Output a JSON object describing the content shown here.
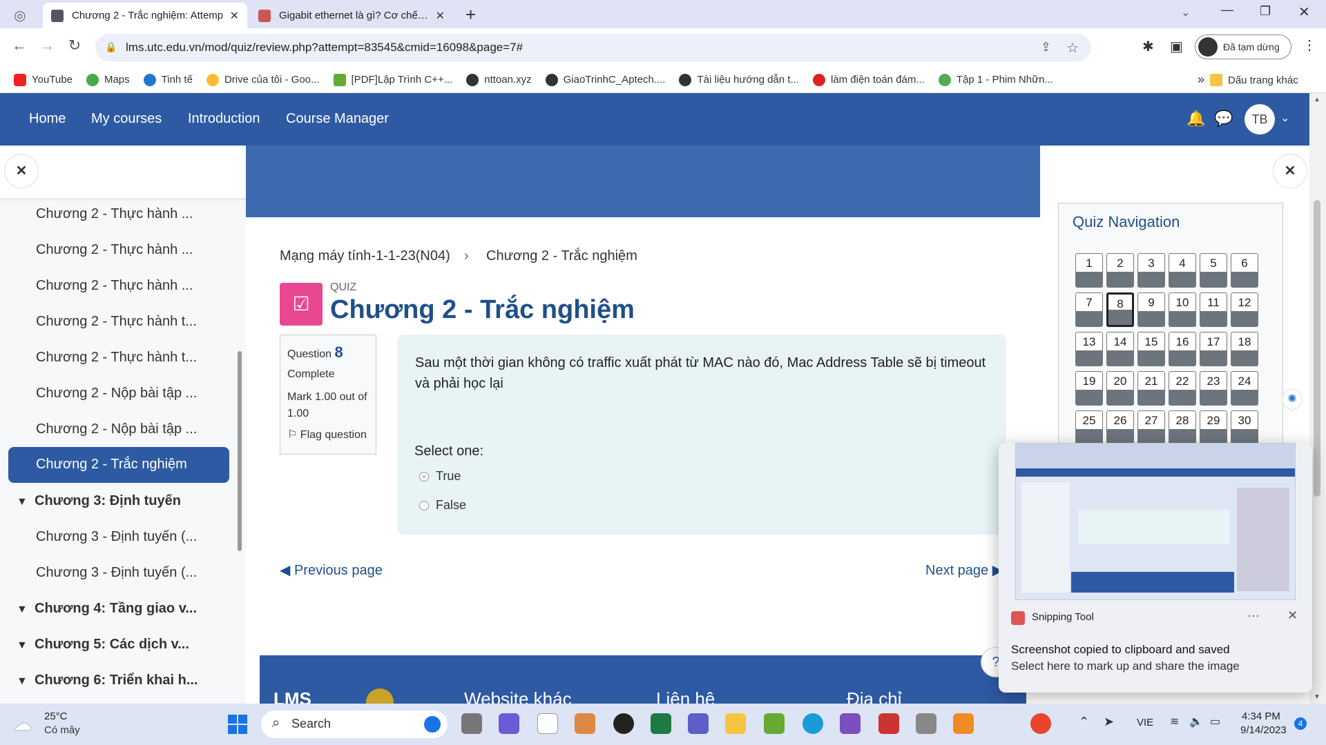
{
  "browser": {
    "tabs": [
      {
        "title": "Chương 2 - Trắc nghiệm: Attemp",
        "active": true
      },
      {
        "title": "Gigabit ethernet là gì? Cơ chế ho",
        "active": false
      }
    ],
    "url": "lms.utc.edu.vn/mod/quiz/review.php?attempt=83545&cmid=16098&page=7#",
    "profile_label": "Đã tạm dừng",
    "bookmarks": [
      "YouTube",
      "Maps",
      "Tinh tế",
      "Drive của tôi - Goo...",
      "[PDF]Lập Trình C++...",
      "nttoan.xyz",
      "GiaoTrinhC_Aptech....",
      "Tài liệu hướng dẫn t...",
      "làm điện toán đám...",
      "Tập 1 - Phim Nhữn..."
    ],
    "bookmarks_more": "»",
    "other_bookmarks": "Dấu trang khác"
  },
  "nav": {
    "items": [
      "Home",
      "My courses",
      "Introduction",
      "Course Manager"
    ],
    "avatar": "TB"
  },
  "sidebar": {
    "items": [
      {
        "label": "Chương 2 - Thực hành ...",
        "type": "item"
      },
      {
        "label": "Chương 2 - Thực hành ...",
        "type": "item"
      },
      {
        "label": "Chương 2 - Thực hành ...",
        "type": "item"
      },
      {
        "label": "Chương 2 - Thực hành t...",
        "type": "item"
      },
      {
        "label": "Chương 2 - Thực hành t...",
        "type": "item"
      },
      {
        "label": "Chương 2 - Nộp bài tập ...",
        "type": "item"
      },
      {
        "label": "Chương 2 - Nộp bài tập ...",
        "type": "item"
      },
      {
        "label": "Chương 2 - Trắc nghiệm",
        "type": "active"
      },
      {
        "label": "Chương 3: Định tuyến",
        "type": "section"
      },
      {
        "label": "Chương 3 - Định tuyến (...",
        "type": "item"
      },
      {
        "label": "Chương 3 - Định tuyến (...",
        "type": "item"
      },
      {
        "label": "Chương 4: Tầng giao v...",
        "type": "section"
      },
      {
        "label": "Chương 5: Các dịch v...",
        "type": "section"
      },
      {
        "label": "Chương 6: Triển khai h...",
        "type": "section"
      }
    ]
  },
  "breadcrumb": [
    "Mạng máy tính-1-1-23(N04)",
    "Chương 2 - Trắc nghiệm"
  ],
  "quiz": {
    "label": "QUIZ",
    "title": "Chương 2 - Trắc nghiệm"
  },
  "question": {
    "prefix": "Question",
    "number": "8",
    "state": "Complete",
    "mark": "Mark 1.00 out of 1.00",
    "flag": "Flag question",
    "text": "Sau một thời gian không có traffic xuất phát từ MAC nào đó, Mac Address Table sẽ bị timeout và phải học lại",
    "select_label": "Select one:",
    "options": [
      {
        "label": "True",
        "selected": true
      },
      {
        "label": "False",
        "selected": false
      }
    ]
  },
  "pager": {
    "prev": "Previous page",
    "next": "Next page"
  },
  "footer": {
    "logo": "LMS",
    "col1": "Website khác",
    "col2": "Liên hệ",
    "col3": "Địa chỉ"
  },
  "quiz_nav": {
    "title": "Quiz Navigation",
    "numbers": [
      "1",
      "2",
      "3",
      "4",
      "5",
      "6",
      "7",
      "8",
      "9",
      "10",
      "11",
      "12",
      "13",
      "14",
      "15",
      "16",
      "17",
      "18",
      "19",
      "20",
      "21",
      "22",
      "23",
      "24",
      "25",
      "26",
      "27",
      "28",
      "29",
      "30"
    ],
    "current": "8"
  },
  "toast": {
    "app": "Snipping Tool",
    "heading": "Screenshot copied to clipboard and saved",
    "subtext": "Select here to mark up and share the image"
  },
  "taskbar": {
    "weather_temp": "25°C",
    "weather_text": "Có mây",
    "search": "Search",
    "lang": "VIE",
    "time": "4:34 PM",
    "date": "9/14/2023",
    "notif_count": "4"
  }
}
